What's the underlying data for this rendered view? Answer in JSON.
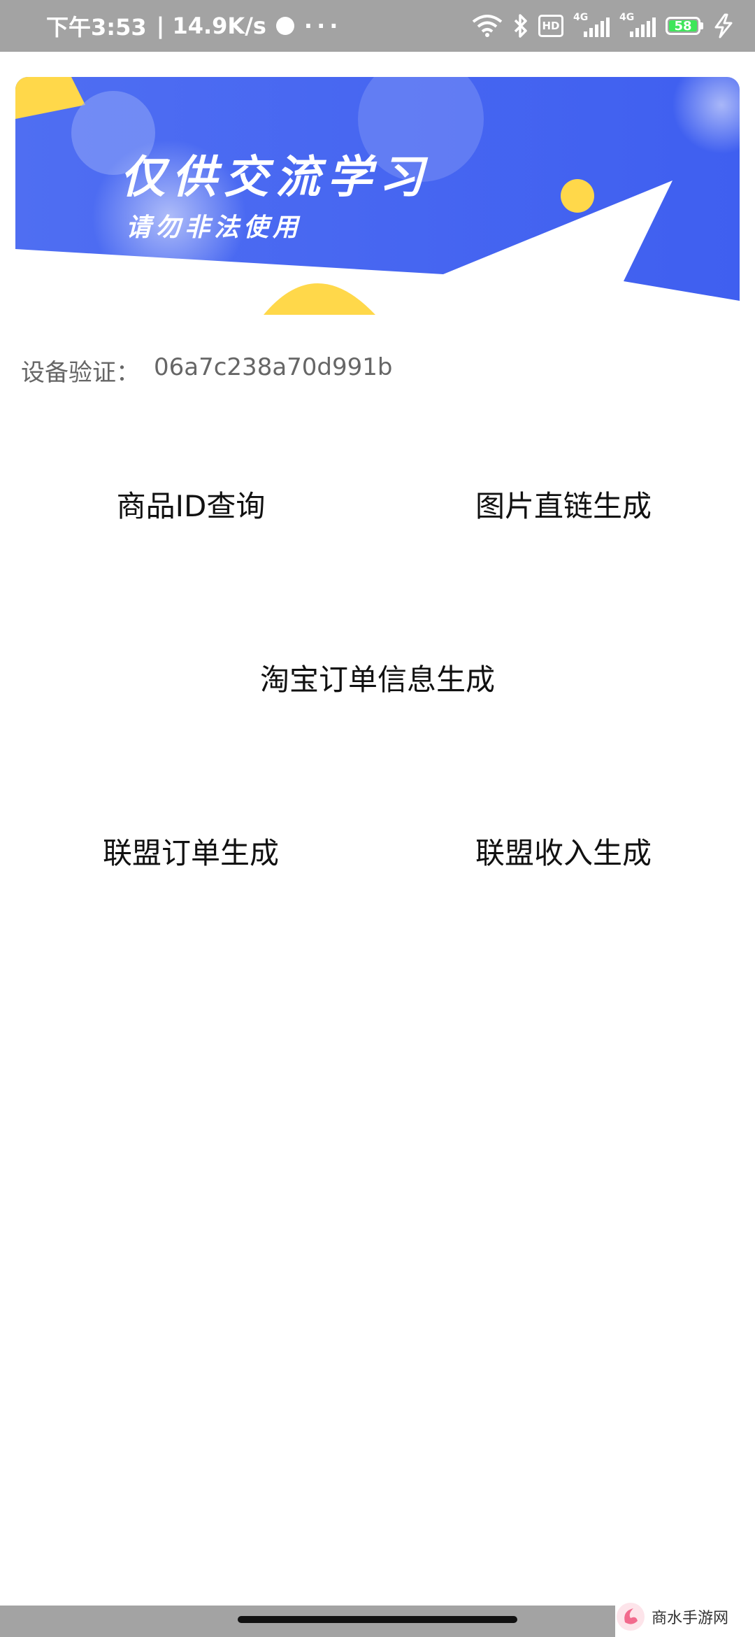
{
  "status_bar": {
    "time": "下午3:53",
    "speed": "| 14.9K/s",
    "more": "···",
    "hd": "HD",
    "net1": "4G",
    "net2": "4G",
    "battery": "58"
  },
  "banner": {
    "title": "仅供交流学习",
    "subtitle": "请勿非法使用"
  },
  "device": {
    "label": "设备验证：",
    "value": "06a7c238a70d991b"
  },
  "menu": {
    "product_id_query": "商品ID查询",
    "image_link_gen": "图片直链生成",
    "taobao_order_gen": "淘宝订单信息生成",
    "union_order_gen": "联盟订单生成",
    "union_income_gen": "联盟收入生成"
  },
  "watermark": {
    "text": "商水手游网"
  },
  "colors": {
    "banner_blue": "#4a6cf0",
    "banner_yellow": "#ffd84a",
    "status_bar": "#a3a3a3",
    "battery_green": "#3ee65a"
  }
}
